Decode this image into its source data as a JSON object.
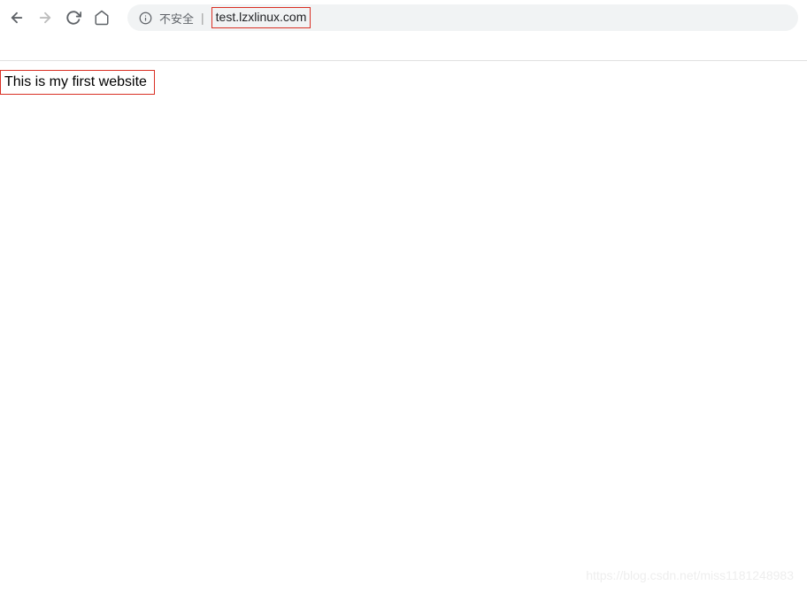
{
  "toolbar": {
    "security_label": "不安全",
    "url": "test.lzxlinux.com"
  },
  "page": {
    "content": "This is my first website"
  },
  "watermark": "https://blog.csdn.net/miss1181248983"
}
